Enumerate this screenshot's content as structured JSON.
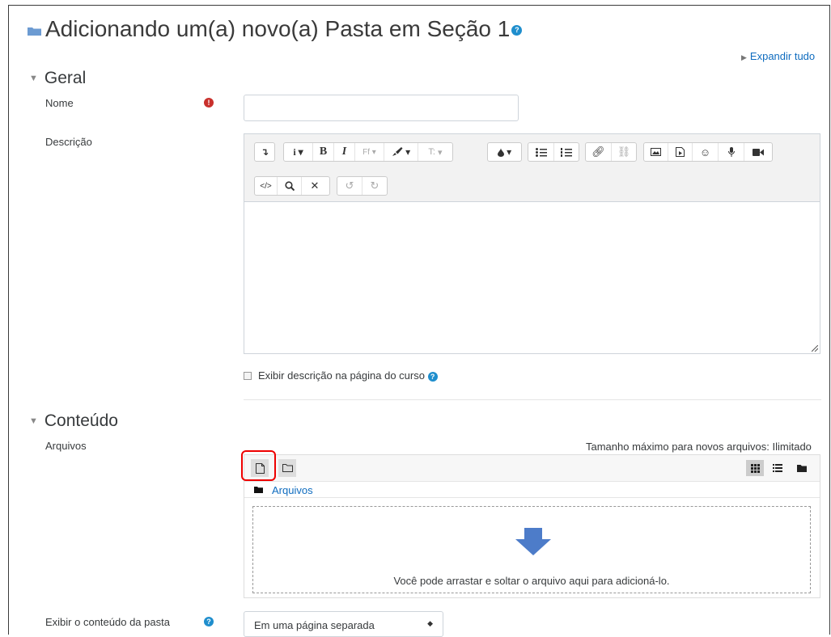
{
  "header": {
    "title": "Adicionando um(a) novo(a) Pasta em Seção 1",
    "expand_all": "Expandir tudo"
  },
  "sections": {
    "general": "Geral",
    "content": "Conteúdo"
  },
  "fields": {
    "name_label": "Nome",
    "name_value": "",
    "description_label": "Descrição",
    "show_description_label": "Exibir descrição na página do curso",
    "files_label": "Arquivos",
    "max_size_text": "Tamanho máximo para novos arquivos: Ilimitado",
    "folder_breadcrumb": "Arquivos",
    "drop_text": "Você pode arrastar e soltar o arquivo aqui para adicioná-lo.",
    "display_label": "Exibir o conteúdo da pasta",
    "display_value": "Em uma página separada"
  },
  "toolbar": {
    "row1": [
      "show-more-icon",
      "info-icon",
      "bold-icon",
      "italic-icon",
      "font-family-icon",
      "paint-brush-icon",
      "font-size-icon",
      "font-color-icon",
      "bullet-list-icon",
      "numbered-list-icon",
      "link-icon",
      "unlink-icon",
      "image-icon",
      "media-icon",
      "emoticon-icon",
      "record-audio-icon",
      "record-video-icon"
    ],
    "row2": [
      "html-icon",
      "find-icon",
      "fullscreen-icon",
      "undo-icon",
      "redo-icon"
    ],
    "glyphs": {
      "bold": "B",
      "italic": "I",
      "font_family": "Ff",
      "font_size": "T:",
      "info": "i"
    }
  },
  "colors": {
    "link": "#0f6cbf",
    "required": "#c9302c",
    "help": "#1f8ecd",
    "drop_arrow": "#4d7cc9",
    "highlight": "#e00000"
  }
}
